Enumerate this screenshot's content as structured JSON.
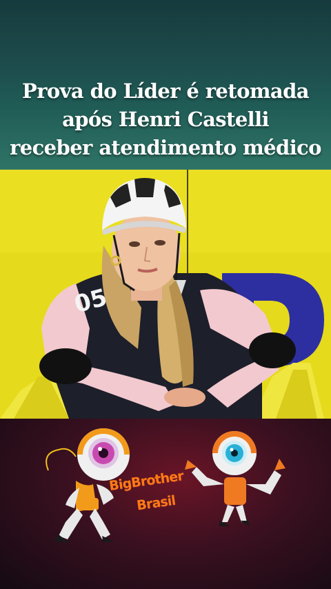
{
  "headline": {
    "line1": "Prova do Líder é retomada",
    "line2": "após Henri Castelli",
    "line3": "receber atendimento médico"
  },
  "photo": {
    "jersey_number": "05",
    "background_letter": "P"
  },
  "logo": {
    "line1": "BigBrother",
    "line2": "Brasil"
  },
  "colors": {
    "header_top": "#163a3d",
    "header_bottom": "#2f7466",
    "photo_bg": "#e7dc1e",
    "logo_orange": "#ff7a14",
    "logo_bg": "#3a1020"
  },
  "icons": [
    "bbb-robot-mascot-left-icon",
    "bbb-robot-mascot-right-icon"
  ]
}
